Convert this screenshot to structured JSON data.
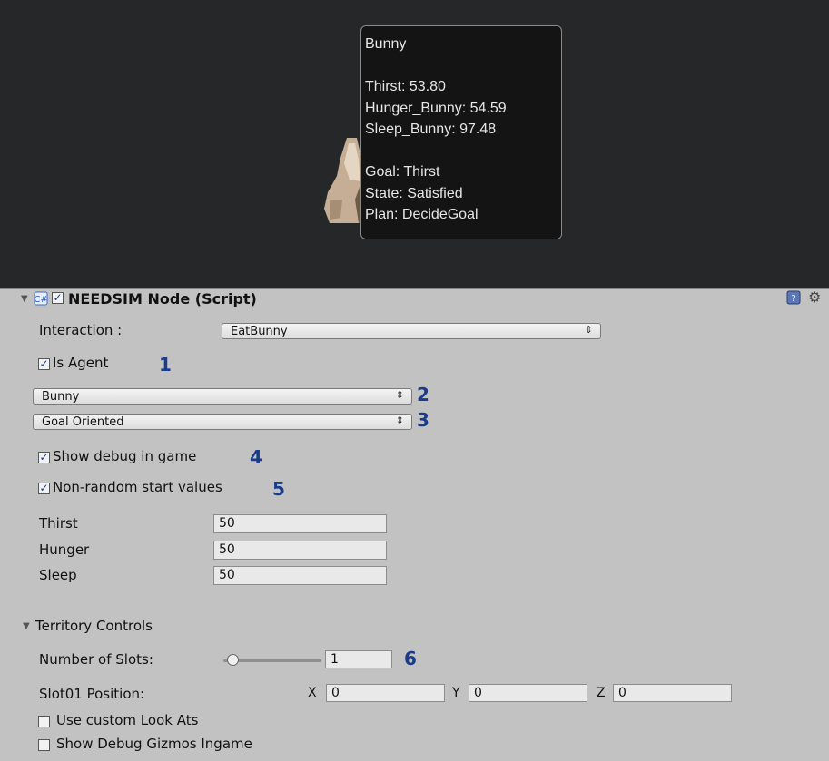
{
  "tooltip": {
    "name": "Bunny",
    "lines": [
      "Thirst: 53.80",
      "Hunger_Bunny: 54.59",
      "Sleep_Bunny: 97.48"
    ],
    "goal": "Goal: Thirst",
    "state": "State: Satisfied",
    "plan": "Plan: DecideGoal"
  },
  "component": {
    "title": "NEEDSIM Node (Script)",
    "script_icon": "csharp-script-icon",
    "help_icon": "help-book-icon",
    "gear_icon": "gear-icon"
  },
  "interaction": {
    "label": "Interaction :",
    "value": "EatBunny"
  },
  "is_agent": {
    "label": "Is Agent",
    "checked": true
  },
  "species_popup": {
    "value": "Bunny"
  },
  "behavior_popup": {
    "value": "Goal Oriented"
  },
  "show_debug": {
    "label": "Show debug in game",
    "checked": true
  },
  "non_random": {
    "label": "Non-random start values",
    "checked": true
  },
  "needs": [
    {
      "label": "Thirst",
      "value": "50"
    },
    {
      "label": "Hunger",
      "value": "50"
    },
    {
      "label": "Sleep",
      "value": "50"
    }
  ],
  "territory": {
    "header": "Territory Controls",
    "slots_label": "Number of Slots:",
    "slots_value": "1",
    "slider_fraction": 0,
    "slot_label": "Slot01 Position:",
    "x_label": "X",
    "x_value": "0",
    "y_label": "Y",
    "y_value": "0",
    "z_label": "Z",
    "z_value": "0",
    "custom_look": {
      "label": "Use custom Look Ats",
      "checked": false
    },
    "gizmos": {
      "label": "Show Debug Gizmos Ingame",
      "checked": false
    }
  },
  "annotations": [
    "1",
    "2",
    "3",
    "4",
    "5",
    "6"
  ],
  "colors": {
    "annotation": "#1a3a8c",
    "game_bg": "#262729",
    "inspector_bg": "#c2c2c2"
  }
}
